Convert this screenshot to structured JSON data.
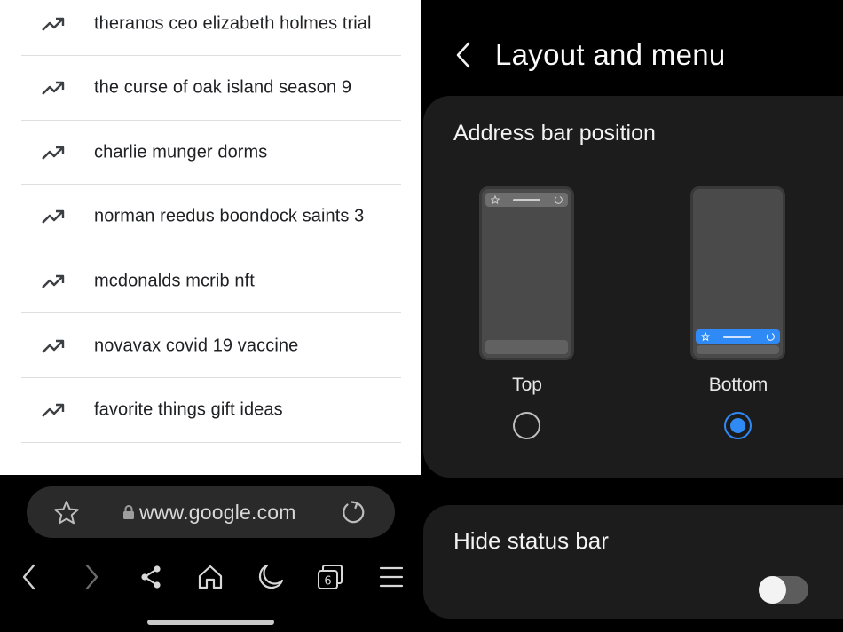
{
  "trending": [
    "theranos ceo elizabeth holmes trial",
    "the curse of oak island season 9",
    "charlie munger dorms",
    "norman reedus boondock saints 3",
    "mcdonalds mcrib nft",
    "novavax covid 19 vaccine",
    "favorite things gift ideas"
  ],
  "browser": {
    "url": "www.google.com",
    "tab_count": "6",
    "icons": {
      "bookmark": "star-icon",
      "secure": "lock-icon",
      "reload": "reload-icon",
      "back": "chevron-left-icon",
      "forward": "chevron-right-icon",
      "share": "share-icon",
      "home": "home-icon",
      "dark_mode": "moon-icon",
      "tabs": "tabs-icon",
      "menu": "hamburger-menu-icon"
    }
  },
  "settings": {
    "title": "Layout and menu",
    "address_bar": {
      "heading": "Address bar position",
      "options": [
        {
          "label": "Top",
          "selected": false
        },
        {
          "label": "Bottom",
          "selected": true
        }
      ]
    },
    "status_bar": {
      "heading": "Hide status bar",
      "enabled": false
    }
  },
  "colors": {
    "accent": "#2f8af5",
    "card_bg": "#1c1c1c",
    "page_bg": "#000000"
  }
}
